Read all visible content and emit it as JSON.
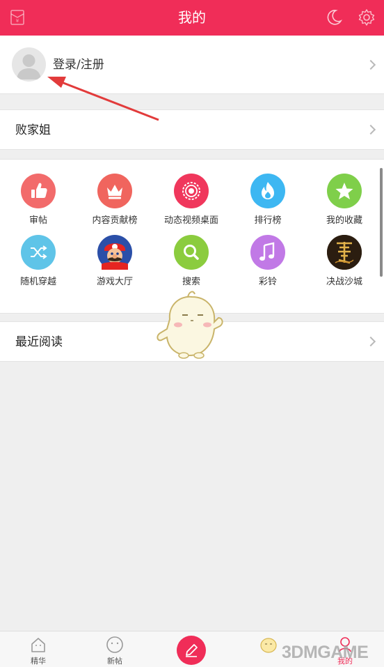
{
  "header": {
    "title": "我的",
    "accent_color": "#f02d58",
    "left_icon": "envelope-icon",
    "right_icons": [
      "moon-icon",
      "gear-icon"
    ]
  },
  "account": {
    "login_label": "登录/注册"
  },
  "menu": {
    "baijiajie_label": "败家姐",
    "recent_label": "最近阅读"
  },
  "grid": {
    "items": [
      {
        "label": "审帖",
        "icon": "thumbs-up-icon",
        "color": "#f26b6b"
      },
      {
        "label": "内容贡献榜",
        "icon": "crown-icon",
        "color": "#f0655e"
      },
      {
        "label": "动态视频桌面",
        "icon": "record-icon",
        "color": "#f0375c"
      },
      {
        "label": "排行榜",
        "icon": "flame-icon",
        "color": "#3db7f2"
      },
      {
        "label": "我的收藏",
        "icon": "star-icon",
        "color": "#7fcf4a"
      },
      {
        "label": "随机穿越",
        "icon": "shuffle-icon",
        "color": "#5fc4e8"
      },
      {
        "label": "游戏大厅",
        "icon": "mario-game-icon",
        "color": "#2b4fa8"
      },
      {
        "label": "搜索",
        "icon": "search-icon",
        "color": "#8bcc3e"
      },
      {
        "label": "彩铃",
        "icon": "music-note-icon",
        "color": "#c179e6"
      },
      {
        "label": "决战沙城",
        "icon": "dragon-game-icon",
        "color": "#3b2a1a"
      }
    ],
    "page_count": 3,
    "active_page": 1
  },
  "tabbar": {
    "tabs": [
      {
        "label": "精华",
        "icon": "house-icon"
      },
      {
        "label": "新帖",
        "icon": "smile-icon"
      },
      {
        "label": "",
        "icon": "compose-icon"
      },
      {
        "label": "",
        "icon": "mascot-icon"
      },
      {
        "label": "我的",
        "icon": "profile-icon"
      }
    ]
  },
  "watermark": "3DMGAME"
}
